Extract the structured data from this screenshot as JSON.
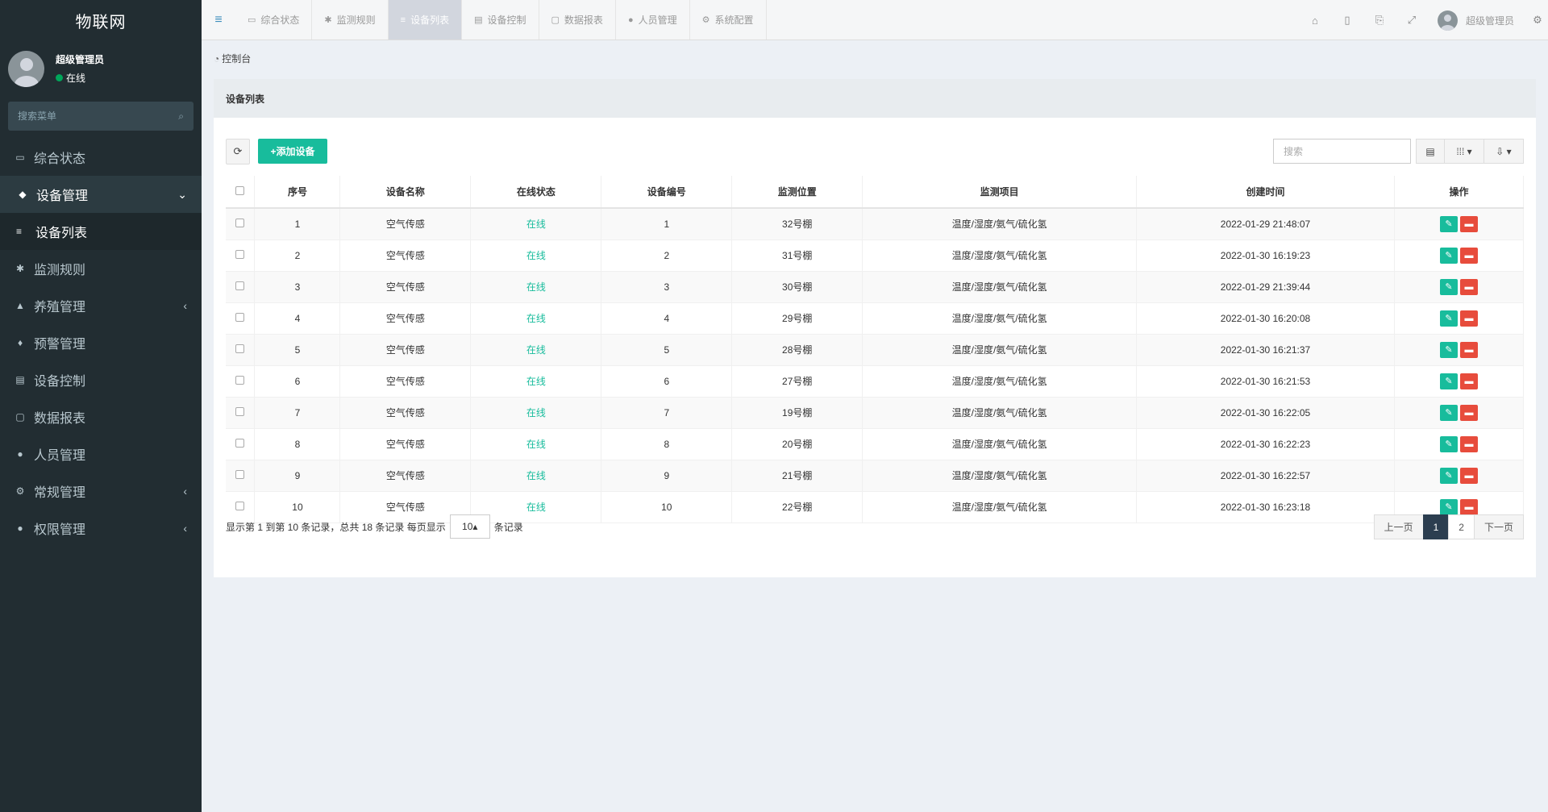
{
  "sidebar": {
    "logo": "物联网",
    "user": {
      "name": "超级管理员",
      "status": "在线"
    },
    "search_placeholder": "搜索菜单",
    "items": [
      {
        "label": "综合状态",
        "icon": "monitor-icon",
        "glyph": "▭"
      },
      {
        "label": "设备管理",
        "icon": "device-icon",
        "glyph": "◆",
        "expanded": true
      },
      {
        "label": "设备列表",
        "icon": "list-icon",
        "glyph": "≡",
        "sub": true
      },
      {
        "label": "监测规则",
        "icon": "asterisk-icon",
        "glyph": "✱"
      },
      {
        "label": "养殖管理",
        "icon": "area-chart-icon",
        "glyph": "▲",
        "collapsible": true
      },
      {
        "label": "预警管理",
        "icon": "bell-icon",
        "glyph": "♦"
      },
      {
        "label": "设备控制",
        "icon": "film-icon",
        "glyph": "▤"
      },
      {
        "label": "数据报表",
        "icon": "file-chart-icon",
        "glyph": "▢"
      },
      {
        "label": "人员管理",
        "icon": "user-icon",
        "glyph": "●"
      },
      {
        "label": "常规管理",
        "icon": "cogs-icon",
        "glyph": "⚙",
        "collapsible": true
      },
      {
        "label": "权限管理",
        "icon": "group-icon",
        "glyph": "●",
        "collapsible": true
      }
    ]
  },
  "topbar": {
    "tabs": [
      {
        "label": "综合状态",
        "icon": "monitor-icon",
        "glyph": "▭"
      },
      {
        "label": "监测规则",
        "icon": "asterisk-icon",
        "glyph": "✱"
      },
      {
        "label": "设备列表",
        "icon": "list-icon",
        "glyph": "≡",
        "active": true
      },
      {
        "label": "设备控制",
        "icon": "film-icon",
        "glyph": "▤"
      },
      {
        "label": "数据报表",
        "icon": "file-chart-icon",
        "glyph": "▢"
      },
      {
        "label": "人员管理",
        "icon": "user-icon",
        "glyph": "●"
      },
      {
        "label": "系统配置",
        "icon": "gear-icon",
        "glyph": "⚙"
      }
    ],
    "user_name": "超级管理员"
  },
  "breadcrumb": "控制台",
  "panel": {
    "title": "设备列表",
    "add_label": "+添加设备",
    "search_placeholder": "搜索"
  },
  "table": {
    "headers": [
      "序号",
      "设备名称",
      "在线状态",
      "设备编号",
      "监测位置",
      "监测项目",
      "创建时间",
      "操作"
    ],
    "rows": [
      [
        "1",
        "空气传感",
        "在线",
        "1",
        "32号棚",
        "温度/湿度/氨气/硫化氢",
        "2022-01-29 21:48:07"
      ],
      [
        "2",
        "空气传感",
        "在线",
        "2",
        "31号棚",
        "温度/湿度/氨气/硫化氢",
        "2022-01-30 16:19:23"
      ],
      [
        "3",
        "空气传感",
        "在线",
        "3",
        "30号棚",
        "温度/湿度/氨气/硫化氢",
        "2022-01-29 21:39:44"
      ],
      [
        "4",
        "空气传感",
        "在线",
        "4",
        "29号棚",
        "温度/湿度/氨气/硫化氢",
        "2022-01-30 16:20:08"
      ],
      [
        "5",
        "空气传感",
        "在线",
        "5",
        "28号棚",
        "温度/湿度/氨气/硫化氢",
        "2022-01-30 16:21:37"
      ],
      [
        "6",
        "空气传感",
        "在线",
        "6",
        "27号棚",
        "温度/湿度/氨气/硫化氢",
        "2022-01-30 16:21:53"
      ],
      [
        "7",
        "空气传感",
        "在线",
        "7",
        "19号棚",
        "温度/湿度/氨气/硫化氢",
        "2022-01-30 16:22:05"
      ],
      [
        "8",
        "空气传感",
        "在线",
        "8",
        "20号棚",
        "温度/湿度/氨气/硫化氢",
        "2022-01-30 16:22:23"
      ],
      [
        "9",
        "空气传感",
        "在线",
        "9",
        "21号棚",
        "温度/湿度/氨气/硫化氢",
        "2022-01-30 16:22:57"
      ],
      [
        "10",
        "空气传感",
        "在线",
        "10",
        "22号棚",
        "温度/湿度/氨气/硫化氢",
        "2022-01-30 16:23:18"
      ]
    ]
  },
  "pagination": {
    "info_prefix": "显示第 1 到第 10 条记录，总共 18 条记录 每页显示",
    "page_size": "10▴",
    "info_suffix": "条记录",
    "prev": "上一页",
    "pages": [
      "1",
      "2"
    ],
    "current": "1",
    "next": "下一页"
  },
  "colors": {
    "sidebar_bg": "#222d32",
    "accent_green": "#18bc9c",
    "danger_red": "#e74c3c",
    "pager_active": "#2c3e50"
  }
}
